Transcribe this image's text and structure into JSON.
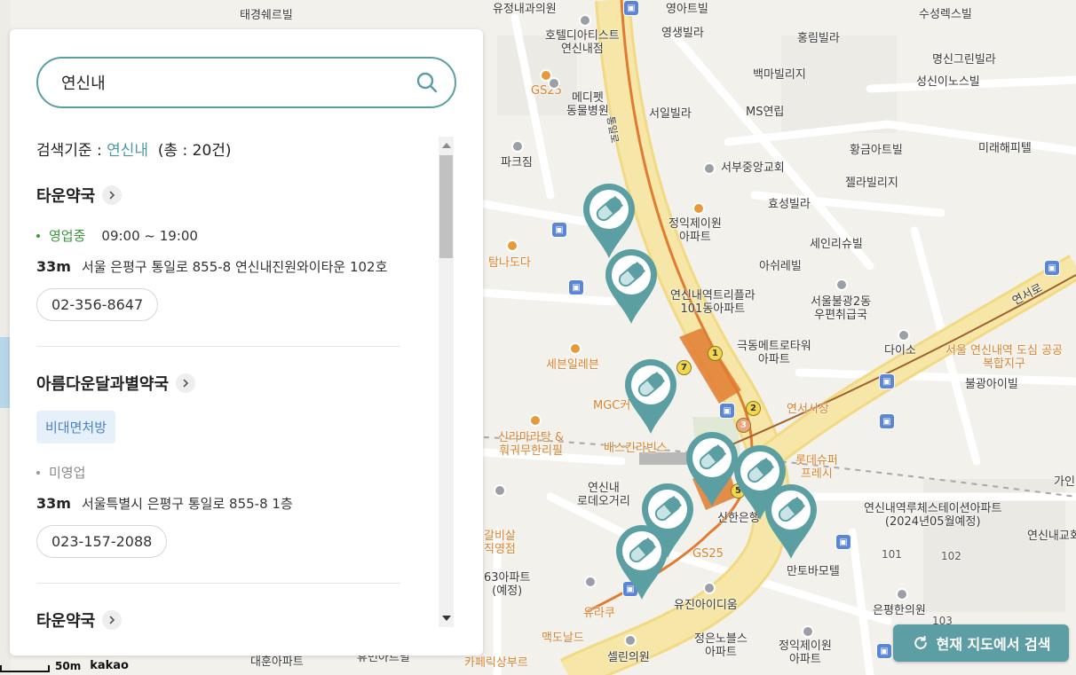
{
  "search": {
    "query": "연신내",
    "criteria_label": "검색기준 :",
    "criteria_keyword": "연신내",
    "total_label": "(총 : 20건)"
  },
  "results": [
    {
      "name": "타운약국",
      "status": "영업중",
      "hours": "09:00 ~ 19:00",
      "distance": "33m",
      "address": "서울 은평구 통일로 855-8 연신내진원와이타운 102호",
      "phone": "02-356-8647"
    },
    {
      "name": "아름다운달과별약국",
      "badge": "비대면처방",
      "status": "미영업",
      "distance": "33m",
      "address": "서울특별시 은평구 통일로 855-8 1층",
      "phone": "023-157-2088"
    },
    {
      "name": "타운약국"
    }
  ],
  "map": {
    "search_here_button": "현재 지도에서 검색",
    "scale_label": "50m",
    "brand": "kakao",
    "labels": {
      "l1": "유정내과의원",
      "l2": "영아트빌",
      "l3": "수성렉스빌",
      "l4": "호텔디아티스트\n연신내점",
      "l5": "영생빌라",
      "l6": "홍림빌라",
      "l7": "명신그린빌라",
      "l8": "GS25",
      "l9": "메디펫\n동물병원",
      "l10": "백마빌리지",
      "l11": "성신이노스빌",
      "l12": "서일빌라",
      "l13": "MS연립",
      "l14": "황금아트빌",
      "l15": "미래해피텔",
      "l16": "파크짐",
      "l17": "서부중앙교회",
      "l18": "젤라빌리지",
      "l19": "정익제이원\n아파트",
      "l20": "효성빌라",
      "l21": "탐나도다",
      "l22": "세인리슈빌",
      "l23": "아쉬레빌",
      "l24": "연신내역트리플라\n101동아파트",
      "l25": "서울불광2동\n우편취급국",
      "l26": "극동메트로타워\n아파트",
      "l27": "다이소",
      "l28": "세븐일레븐",
      "l29": "서울 연신내역 도심 공공\n복합지구",
      "l30": "불광아이빌",
      "l31": "연서시장",
      "l32": "신라마라탕 &\n훠궈무한리필",
      "l33": "배스킨라빈스",
      "l34": "롯데슈퍼\n프레시",
      "l35": "연신내\n로데오거리",
      "l36": "신한은행",
      "l37": "연신내역루체스테이션아파트\n(2024년05월예정)",
      "l38": "연신내교회",
      "l39": "GS25",
      "l40": "만토바모텔",
      "l41": "유진아이디움",
      "l42": "은평한의원",
      "l43": "맥도날드",
      "l44": "셀린의원",
      "l45": "정은노블스\n아파트",
      "l46": "정익제이원\n아파트",
      "l47": "대훈아파트",
      "l48": "휴먼아트빌",
      "l49": "카페릭상부르",
      "l50": "유라쿠",
      "l51": "태경쉐르빌",
      "l52": "연서로",
      "l53": "MGC커",
      "l54": "63아파트\n(예정)",
      "l55": "갈비살\n직영점",
      "l56": "가인",
      "l57": "101",
      "l58": "102",
      "l59": "103",
      "l60": "통일로"
    }
  }
}
